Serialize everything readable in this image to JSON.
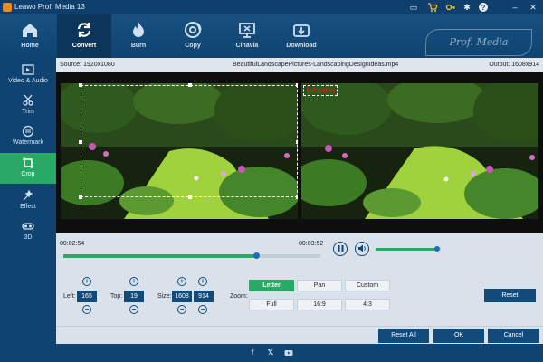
{
  "app": {
    "title": "Leawo Prof. Media 13"
  },
  "window_controls": [
    {
      "name": "screen-icon"
    },
    {
      "name": "cart-icon"
    },
    {
      "name": "key-icon"
    },
    {
      "name": "gear-icon"
    },
    {
      "name": "help-icon"
    },
    {
      "name": "minimize-icon"
    },
    {
      "name": "close-icon"
    }
  ],
  "nav": {
    "tabs": [
      {
        "label": "Home",
        "icon": "home-icon",
        "active": false
      },
      {
        "label": "Convert",
        "icon": "convert-icon",
        "active": true
      },
      {
        "label": "Burn",
        "icon": "burn-icon",
        "active": false
      },
      {
        "label": "Copy",
        "icon": "copy-icon",
        "active": false
      },
      {
        "label": "Cinavia",
        "icon": "cinavia-icon",
        "active": false
      },
      {
        "label": "Download",
        "icon": "download-icon",
        "active": false
      }
    ],
    "brand": "Prof. Media"
  },
  "sidebar": {
    "items": [
      {
        "label": "Video & Audio",
        "icon": "video-audio-icon",
        "active": false
      },
      {
        "label": "Trim",
        "icon": "trim-icon",
        "active": false
      },
      {
        "label": "Watermark",
        "icon": "watermark-icon",
        "active": false
      },
      {
        "label": "Crop",
        "icon": "crop-icon",
        "active": true
      },
      {
        "label": "Effect",
        "icon": "effect-icon",
        "active": false
      },
      {
        "label": "3D",
        "icon": "3d-icon",
        "active": false
      }
    ]
  },
  "info": {
    "source": "Source: 1920x1080",
    "filename": "BeautifulLandscapePictures-LandscapingDesignIdeas.mp4",
    "output": "Output: 1608x914"
  },
  "preview": {
    "watermark_text": "Leawo"
  },
  "playback": {
    "current_time": "00:02:54",
    "total_time": "00:03:52",
    "progress": 0.75,
    "volume": 0.95
  },
  "crop": {
    "left_label": "Left:",
    "left_value": "165",
    "top_label": "Top:",
    "top_value": "19",
    "size_label": "Size:",
    "width_value": "1608",
    "height_value": "914",
    "zoom_label": "Zoom:",
    "zoom_options": [
      "Letter",
      "Pan",
      "Custom",
      "Full",
      "16:9",
      "4:3"
    ],
    "zoom_selected": "Letter",
    "reset_label": "Reset"
  },
  "buttons": {
    "reset_all": "Reset All",
    "ok": "OK",
    "cancel": "Cancel"
  },
  "colors": {
    "accent_green": "#2aa866",
    "nav_blue": "#0f4472",
    "button_blue": "#124a7a"
  }
}
